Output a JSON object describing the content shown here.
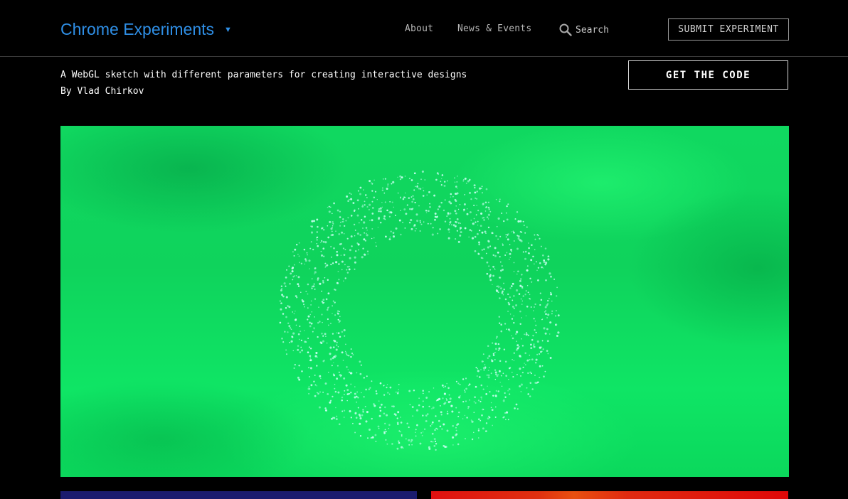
{
  "header": {
    "brand": "Chrome Experiments",
    "brand_caret": "▼",
    "nav": {
      "about": "About",
      "news_events": "News & Events"
    },
    "search_label": "Search",
    "submit_button": "SUBMIT EXPERIMENT"
  },
  "experiment": {
    "description": "A WebGL sketch with different parameters for creating interactive designs",
    "author": "By Vlad Chirkov",
    "get_code_button": "GET THE CODE"
  },
  "colors": {
    "brand": "#2f8fe6",
    "canvas_green": "#10d860",
    "particle": "#c8fff0",
    "thumb_left": "#1b1b6e",
    "thumb_right": "#e01010"
  },
  "icons": {
    "search": "search-icon",
    "caret": "chevron-down-icon"
  }
}
